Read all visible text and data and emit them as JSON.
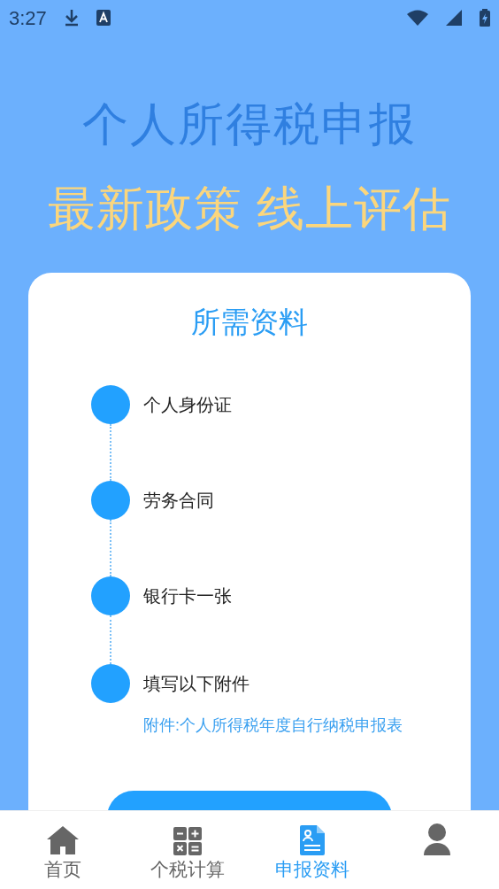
{
  "status_bar": {
    "time": "3:27"
  },
  "headline": "个人所得税申报",
  "subheadline": "最新政策 线上评估",
  "card": {
    "title": "所需资料",
    "steps": [
      {
        "label": "个人身份证"
      },
      {
        "label": "劳务合同"
      },
      {
        "label": "银行卡一张"
      },
      {
        "label": "填写以下附件"
      }
    ],
    "note": "附件:个人所得税年度自行纳税申报表"
  },
  "tabs": [
    {
      "kind": "home",
      "label": "首页",
      "selected": false
    },
    {
      "kind": "calculator",
      "label": "个税计算",
      "selected": false
    },
    {
      "kind": "document",
      "label": "申报资料",
      "selected": true
    },
    {
      "kind": "person",
      "selected": false
    }
  ]
}
